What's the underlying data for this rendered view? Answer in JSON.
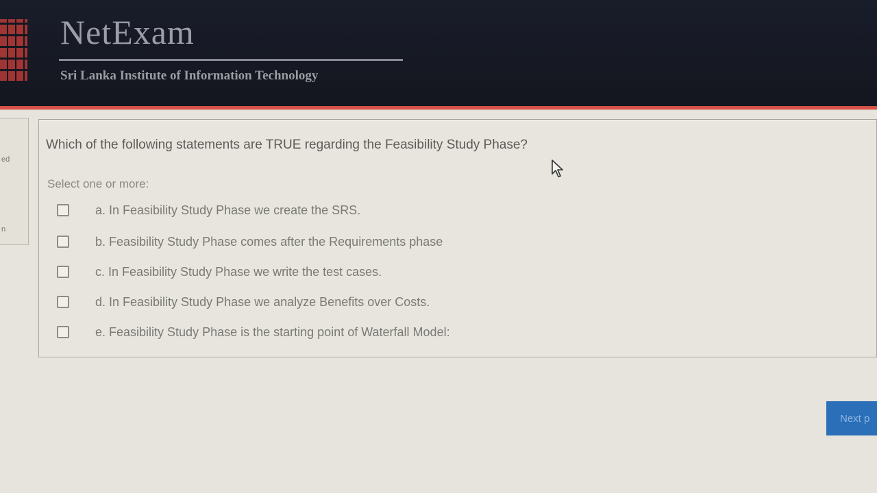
{
  "header": {
    "brand": "NetExam",
    "institute": "Sri Lanka Institute of Information Technology"
  },
  "left_panel": {
    "fragment_top": "ed",
    "fragment_bottom": "n"
  },
  "question": {
    "text": "Which of the following statements are TRUE regarding the Feasibility Study Phase?",
    "instruction": "Select one or more:",
    "options": [
      {
        "label": "a. In Feasibility Study Phase we create the SRS.",
        "checked": false
      },
      {
        "label": "b. Feasibility Study Phase comes after the Requirements phase",
        "checked": false
      },
      {
        "label": "c. In Feasibility Study Phase we write the test cases.",
        "checked": false
      },
      {
        "label": "d. In Feasibility Study Phase we analyze Benefits over Costs.",
        "checked": false
      },
      {
        "label": "e. Feasibility Study Phase is the starting point of Waterfall Model:",
        "checked": false
      }
    ]
  },
  "navigation": {
    "next_label": "Next p"
  },
  "colors": {
    "header_bg": "#191d2a",
    "accent_red": "#d9534a",
    "next_button": "#2a6fb8"
  }
}
